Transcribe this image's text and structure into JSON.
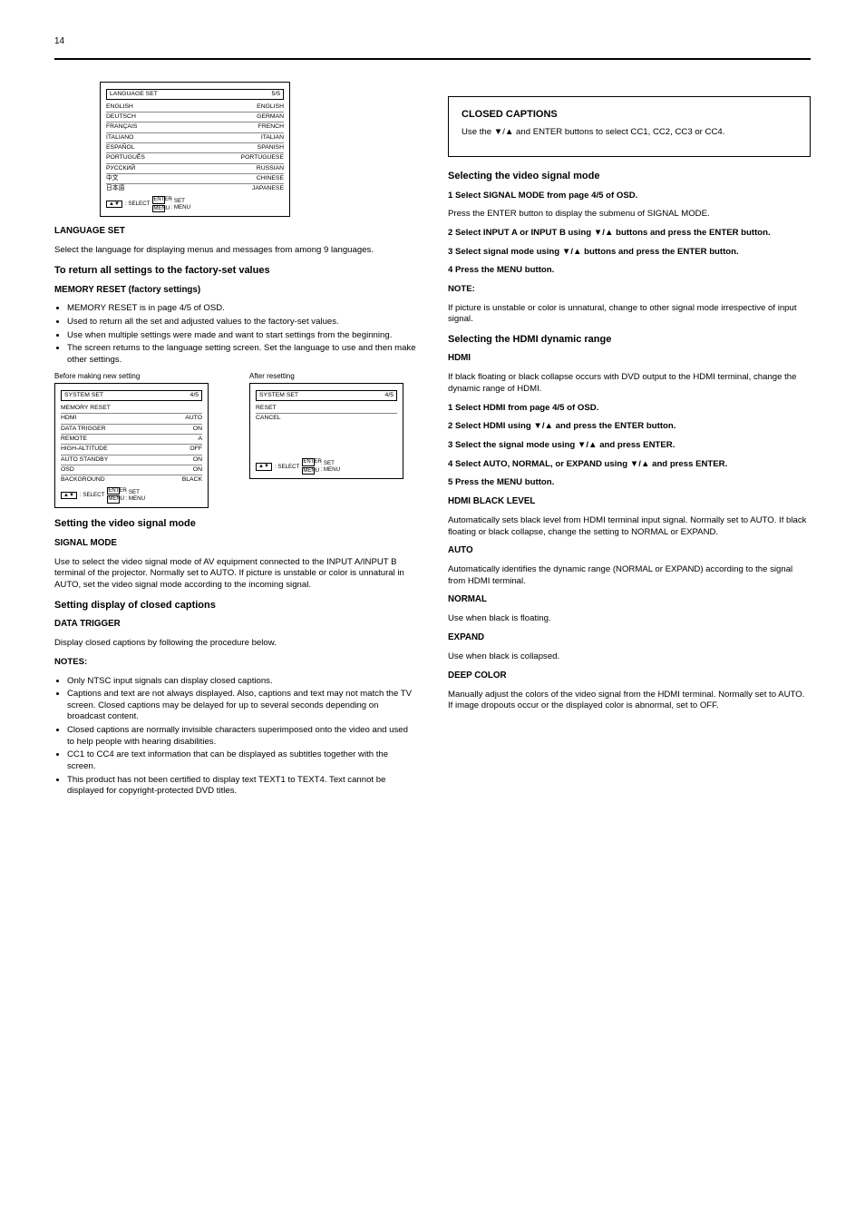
{
  "pageNumber": "14",
  "screen_language": {
    "title": "LANGUAGE SET",
    "titleRight": "5/5",
    "rows": [
      {
        "label": "ENGLISH",
        "value": "ENGLISH"
      },
      {
        "label": "DEUTSCH",
        "value": "GERMAN"
      },
      {
        "label": "FRANÇAIS",
        "value": "FRENCH"
      },
      {
        "label": "ITALIANO",
        "value": "ITALIAN"
      },
      {
        "label": "ESPAÑOL",
        "value": "SPANISH"
      },
      {
        "label": "PORTUGUÊS",
        "value": "PORTUGUESE"
      },
      {
        "label": "РУССКИЙ",
        "value": "RUSSIAN"
      },
      {
        "label": "中文",
        "value": "CHINESE"
      },
      {
        "label": "日本語",
        "value": "JAPANESE"
      }
    ],
    "hintSelect": ": SELECT",
    "hintSet": ": SET",
    "hintMenu": ": MENU"
  },
  "lang_section": {
    "head": "LANGUAGE SET",
    "para": "Select the language for displaying menus and messages from among 9 languages."
  },
  "factory_head": "To return all settings to the factory-set values",
  "factory_section": {
    "head": "MEMORY RESET (factory settings)",
    "bullets": [
      "MEMORY RESET is in page 4/5 of OSD.",
      "Used to return all the set and adjusted values to the factory-set values.",
      "Use when multiple settings were made and want to start settings from the beginning.",
      "The screen returns to the language setting screen. Set the language to use and then make other settings."
    ]
  },
  "before_reset": "Before making new setting",
  "after_reset": "After resetting",
  "screen_before": {
    "title": "SYSTEM SET",
    "titleRight": "4/5",
    "rows": [
      {
        "label": "MEMORY RESET",
        "value": ""
      },
      {
        "label": "HDMI",
        "value": "AUTO"
      },
      {
        "label": "DATA TRIGGER",
        "value": "ON"
      },
      {
        "label": "REMOTE",
        "value": "A"
      },
      {
        "label": "HIGH-ALTITUDE",
        "value": "OFF"
      },
      {
        "label": "AUTO STANDBY",
        "value": "ON"
      },
      {
        "label": "OSD",
        "value": "ON"
      },
      {
        "label": "BACKGROUND",
        "value": "BLACK"
      }
    ],
    "hintSelect": ": SELECT",
    "hintSet": ": SET",
    "hintMenu": ": MENU"
  },
  "screen_after": {
    "title": "SYSTEM SET",
    "titleRight": "4/5",
    "rows": [
      {
        "label": "RESET",
        "value": ""
      },
      {
        "label": "CANCEL",
        "value": ""
      }
    ],
    "hintSelect": ": SELECT",
    "hintSet": ": SET",
    "hintMenu": ": MENU"
  },
  "signal_mode": {
    "head": "Setting the video signal mode",
    "subhead": "SIGNAL MODE",
    "para": "Use to select the video signal mode of AV equipment connected to the INPUT A/INPUT B terminal of the projector. Normally set to AUTO. If picture is unstable or color is unnatural in AUTO, set the video signal mode according to the incoming signal."
  },
  "cc_box": {
    "title": "CLOSED CAPTIONS",
    "body": "Use the ▼/▲ and ENTER buttons to select CC1, CC2, CC3 or CC4."
  },
  "sel_signal": {
    "head": "Selecting the video signal mode",
    "s1": "1 Select SIGNAL MODE from page 4/5 of OSD.",
    "s1b": "Press the ENTER button to display the submenu of SIGNAL MODE.",
    "s2": "2 Select INPUT A or INPUT B using ▼/▲ buttons and press the ENTER button.",
    "s3": "3 Select signal mode using ▼/▲ buttons and press the ENTER button.",
    "s4": "4 Press the MENU button.",
    "note_head": "NOTE:",
    "note_body": "If picture is unstable or color is unnatural, change to other signal mode irrespective of input signal."
  },
  "hdmi": {
    "head": "Selecting the HDMI dynamic range",
    "subhead": "HDMI",
    "para": "If black floating or black collapse occurs with DVD output to the HDMI terminal, change the dynamic range of HDMI.",
    "s1": "1 Select HDMI from page 4/5 of OSD.",
    "s2": "2 Select HDMI using ▼/▲ and press the ENTER button.",
    "s3": "3 Select the signal mode using ▼/▲ and press ENTER.",
    "s4": "4 Select AUTO, NORMAL, or EXPAND using ▼/▲ and press ENTER.",
    "s5": "5 Press the MENU button.",
    "sub2": "HDMI BLACK LEVEL",
    "para2": "Automatically sets black level from HDMI terminal input signal. Normally set to AUTO. If black floating or black collapse, change the setting to NORMAL or EXPAND.",
    "auto": "AUTO",
    "auto_body": "Automatically identifies the dynamic range (NORMAL or EXPAND) according to the signal from HDMI terminal.",
    "normal": "NORMAL",
    "normal_body": "Use when black is floating.",
    "expand": "EXPAND",
    "expand_body": "Use when black is collapsed."
  },
  "dt": {
    "head": "Setting display of closed captions",
    "subhead": "DATA TRIGGER",
    "para": "Display closed captions by following the procedure below."
  },
  "deep": {
    "sub": "DEEP COLOR",
    "para": "Manually adjust the colors of the video signal from the HDMI terminal. Normally set to AUTO. If image dropouts occur or the displayed color is abnormal, set to OFF.",
    "note_head": "NOTES:",
    "n1": "Only NTSC input signals can display closed captions.",
    "n2": "Captions and text are not always displayed. Also, captions and text may not match the TV screen. Closed captions may be delayed for up to several seconds depending on broadcast content.",
    "n3": "Closed captions are normally invisible characters superimposed onto the video and used to help people with hearing disabilities.",
    "n4": "CC1 to CC4 are text information that can be displayed as subtitles together with the screen.",
    "n5": "This product has not been certified to display text TEXT1 to TEXT4. Text cannot be displayed for copyright-protected DVD titles."
  },
  "keys": {
    "enter": "ENTER",
    "menu": "MENU"
  }
}
